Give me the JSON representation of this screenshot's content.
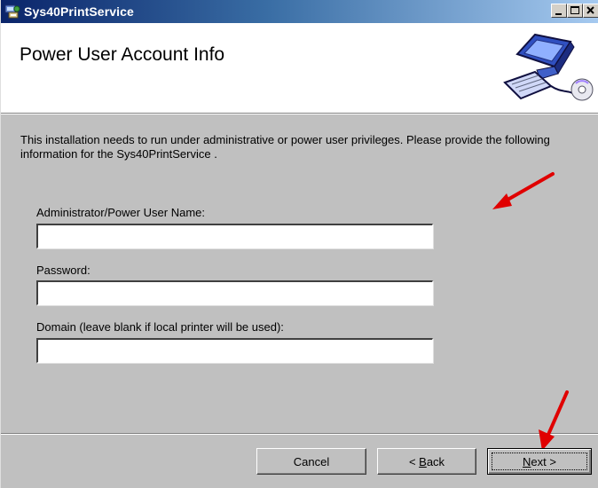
{
  "window": {
    "title": "Sys40PrintService"
  },
  "header": {
    "heading": "Power User Account Info"
  },
  "description": "This installation needs to run under administrative or power user privileges. Please provide the following information for the Sys40PrintService .",
  "form": {
    "user_name_label": "Administrator/Power User Name:",
    "user_name_value": "",
    "password_label": "Password:",
    "password_value": "",
    "domain_label": "Domain (leave blank if local printer will be used):",
    "domain_value": ""
  },
  "buttons": {
    "cancel": "Cancel",
    "back_prefix": "< ",
    "back_mnemonic": "B",
    "back_rest": "ack",
    "next_mnemonic": "N",
    "next_rest": "ext >"
  },
  "icons": {
    "app": "installer-icon",
    "header_graphic": "computer-icon",
    "annotation": "red-arrow-icon"
  },
  "colors": {
    "title_bar_start": "#0a246a",
    "title_bar_end": "#a6caf0",
    "dialog_face": "#c0c0c0",
    "annotation_arrow": "#ff0000"
  }
}
